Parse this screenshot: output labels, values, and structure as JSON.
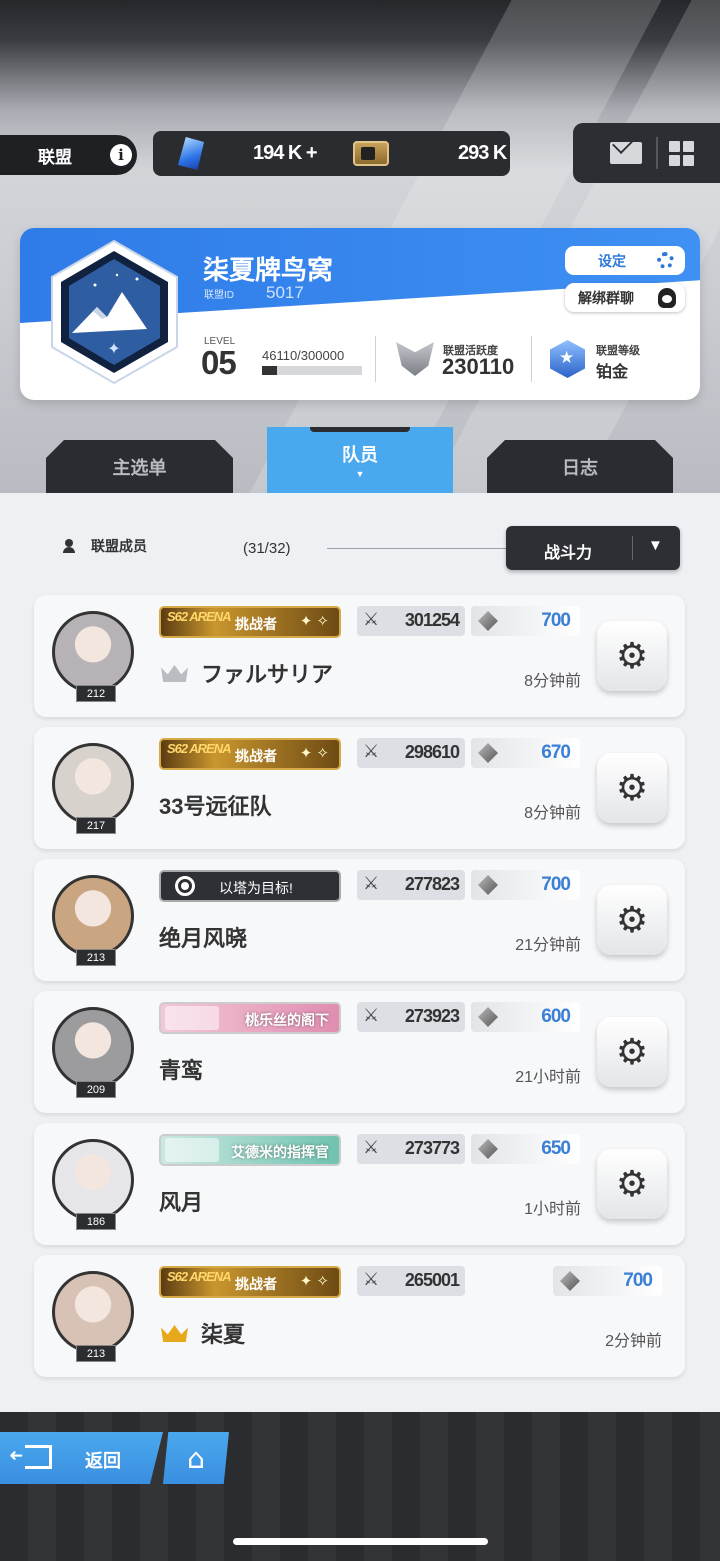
{
  "header": {
    "union_tab_label": "联盟",
    "info_icon": "info-icon",
    "resource1_value": "194 K +",
    "resource2_value": "293 K",
    "mail_icon": "mail-icon",
    "menu_icon": "grid-icon"
  },
  "union": {
    "name": "柒夏牌鸟窝",
    "id_label": "联盟ID",
    "id_value": "5017",
    "settings_label": "设定",
    "unbind_label": "解绑群聊",
    "level_label": "LEVEL",
    "level_value": "05",
    "exp_text": "46110/300000",
    "exp_progress": 0.1537,
    "activity_label": "联盟活跃度",
    "activity_value": "230110",
    "rank_label": "联盟等级",
    "rank_value": "铂金"
  },
  "tabs": [
    {
      "label": "主选单",
      "active": false
    },
    {
      "label": "队员",
      "active": true
    },
    {
      "label": "日志",
      "active": false
    }
  ],
  "list": {
    "members_label": "联盟成员",
    "members_count": "(31/32)",
    "sort_value": "战斗力",
    "sort_arrow": "▼"
  },
  "members": [
    {
      "level": "212",
      "badge_type": "arena",
      "badge_tag": "S62 ARENA",
      "badge_text": "挑战者",
      "power": "301254",
      "gems": "700",
      "name": "ファルサリア",
      "crown": "silver",
      "time": "8分钟前",
      "face_color": "#b7b2b5"
    },
    {
      "level": "217",
      "badge_type": "arena",
      "badge_tag": "S62 ARENA",
      "badge_text": "挑战者",
      "power": "298610",
      "gems": "670",
      "name": "33号远征队",
      "crown": "",
      "time": "8分钟前",
      "face_color": "#d8d2cc"
    },
    {
      "level": "213",
      "badge_type": "target",
      "badge_text": "以塔为目标!",
      "power": "277823",
      "gems": "700",
      "name": "绝月风晓",
      "crown": "",
      "time": "21分钟前",
      "face_color": "#c9a581"
    },
    {
      "level": "209",
      "badge_type": "pink",
      "badge_text": "桃乐丝的阁下",
      "power": "273923",
      "gems": "600",
      "name": "青鸾",
      "crown": "",
      "time": "21小时前",
      "face_color": "#9c9c9e"
    },
    {
      "level": "186",
      "badge_type": "green",
      "badge_text": "艾德米的指挥官",
      "power": "273773",
      "gems": "650",
      "name": "风月",
      "crown": "",
      "time": "1小时前",
      "face_color": "#e6e6ea"
    },
    {
      "level": "213",
      "badge_type": "arena",
      "badge_tag": "S62 ARENA",
      "badge_text": "挑战者",
      "power": "265001",
      "gems": "700",
      "name": "柒夏",
      "crown": "gold",
      "time": "2分钟前",
      "face_color": "#d8c2b5"
    }
  ],
  "footer": {
    "back_label": "返回",
    "home_icon": "home-icon"
  }
}
